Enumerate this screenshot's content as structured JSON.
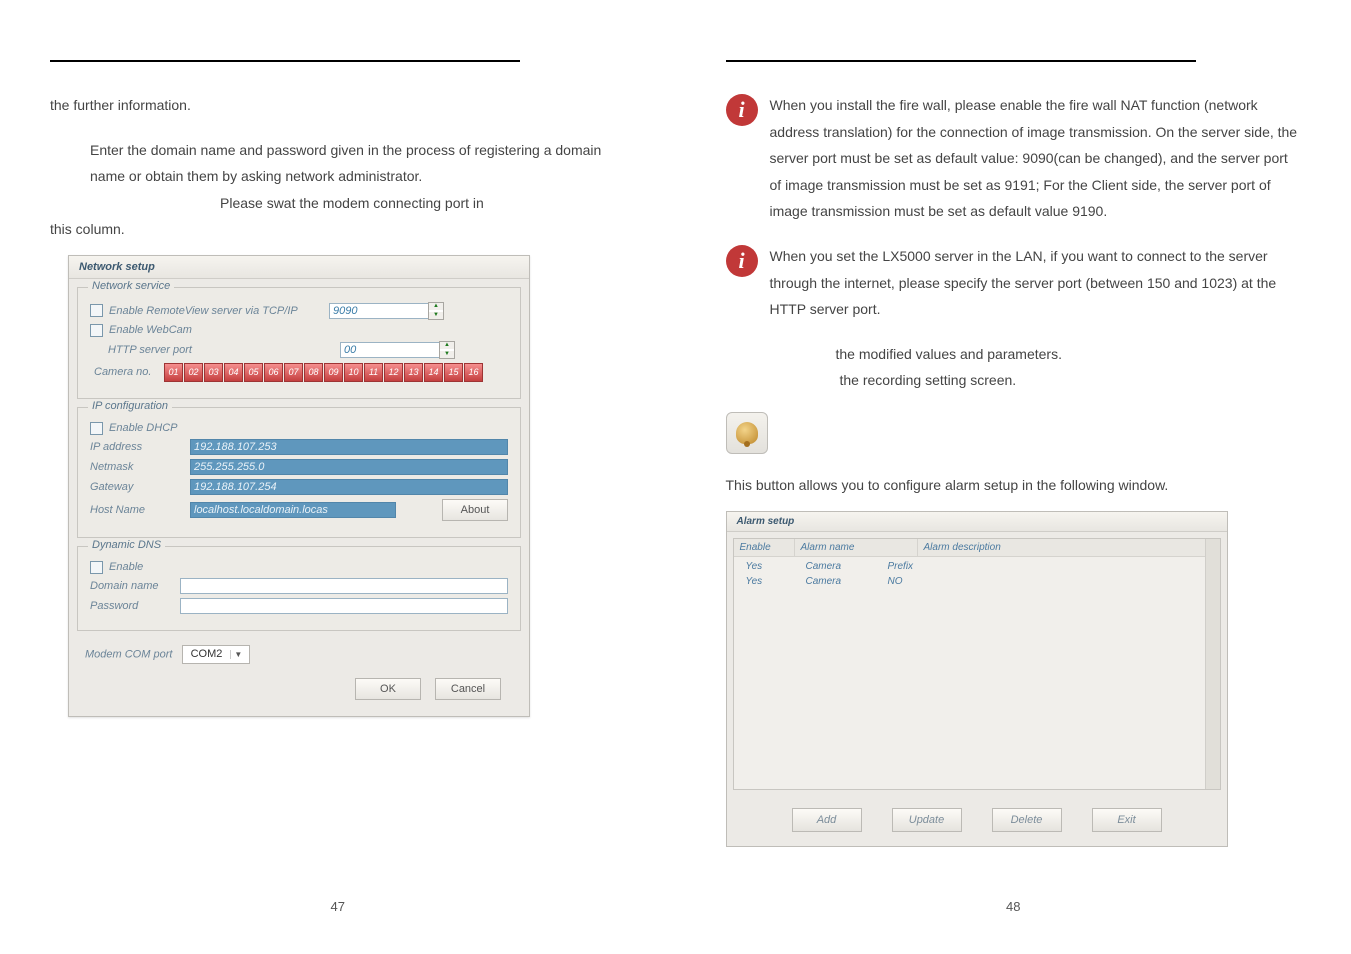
{
  "left": {
    "paragraphs": {
      "p0": "the further information.",
      "p1": "Enter the domain name and password given in the process of registering a domain name or obtain them by asking network administrator.",
      "p2a": "Please swat the modem connecting port in",
      "p2b": "this column."
    },
    "dialog": {
      "title": "Network setup",
      "fieldset_network": "Network service",
      "enable_remote": "Enable RemoteView server via TCP/IP",
      "remote_port": "9090",
      "enable_webcam": "Enable WebCam",
      "http_label": "HTTP server port",
      "http_port": "00",
      "camera_label": "Camera no.",
      "cam_numbers": [
        "01",
        "02",
        "03",
        "04",
        "05",
        "06",
        "07",
        "08",
        "09",
        "10",
        "11",
        "12",
        "13",
        "14",
        "15",
        "16"
      ],
      "fieldset_ip": "IP configuration",
      "enable_dhcp": "Enable DHCP",
      "ip_label": "IP address",
      "ip_value": "192.188.107.253",
      "mask_label": "Netmask",
      "mask_value": "255.255.255.0",
      "gw_label": "Gateway",
      "gw_value": "192.188.107.254",
      "host_label": "Host Name",
      "host_value": "localhost.localdomain.locas",
      "about_btn": "About",
      "fieldset_dns": "Dynamic DNS",
      "dns_enable": "Enable",
      "dns_domain": "Domain name",
      "dns_password": "Password",
      "modem_label": "Modem COM port",
      "modem_value": "COM2",
      "ok": "OK",
      "cancel": "Cancel"
    },
    "page_no": "47"
  },
  "right": {
    "info1": "When you install the fire wall, please enable the fire wall NAT function (network address translation) for the connection of image transmission. On the server side, the server port must be set as default value: 9090(can be changed), and the server port of image transmission must be set as 9191; For the Client side, the server port of image transmission must be set as default value 9190.",
    "info2": "When you set the LX5000 server in the LAN, if you want to connect to the server through the internet, please specify the server port (between 150 and 1023) at the HTTP server port.",
    "bullets": {
      "b1": "the modified values and parameters.",
      "b2": "the recording setting screen."
    },
    "alarm_intro": "This button allows you to configure alarm setup in the following window.",
    "alarm_dialog": {
      "title": "Alarm setup",
      "columns": {
        "c1": "Enable",
        "c2": "Alarm name",
        "c3": "Alarm description"
      },
      "rows": [
        {
          "c1a": "Yes",
          "c1b": "Yes",
          "c2a": "Camera",
          "c2b": "Camera",
          "c3a": "Prefix",
          "c3b": "NO"
        }
      ],
      "buttons": {
        "add": "Add",
        "update": "Update",
        "delete": "Delete",
        "exit": "Exit"
      }
    },
    "page_no": "48"
  }
}
